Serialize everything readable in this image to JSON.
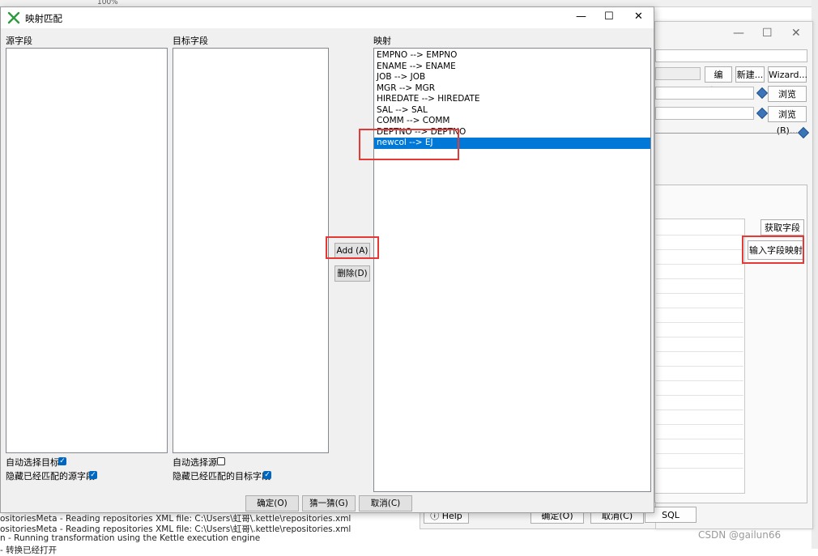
{
  "background": {
    "top_bar_text": "100%",
    "window_controls": [
      "—",
      "☐",
      "✕"
    ],
    "buttons": {
      "edit": "编辑...",
      "new": "新建...",
      "wizard": "Wizard...",
      "browse1": "浏览(B)...",
      "browse2": "浏览(B)...",
      "get_fields": "获取字段",
      "input_field_mapping": "输入字段映射",
      "help": "Help",
      "ok": "确定(O)",
      "cancel": "取消(C)",
      "sql": "SQL"
    },
    "log_lines": [
      "ositoriesMeta - Reading repositories XML file: C:\\Users\\虹哥\\.kettle\\repositories.xml",
      "ositoriesMeta - Reading repositories XML file: C:\\Users\\虹哥\\.kettle\\repositories.xml",
      "n - Running transformation using the Kettle execution engine",
      "- 转换已经打开"
    ]
  },
  "dialog": {
    "title": "映射匹配",
    "controls": {
      "minimize": "—",
      "maximize": "☐",
      "close": "✕"
    },
    "source_label": "源字段",
    "target_label": "目标字段",
    "mapping_label": "映射",
    "mappings": [
      "EMPNO --> EMPNO",
      "ENAME --> ENAME",
      "JOB --> JOB",
      "MGR --> MGR",
      "HIREDATE --> HIREDATE",
      "SAL --> SAL",
      "COMM --> COMM",
      "DEPTNO --> DEPTNO",
      "newcol --> EJ"
    ],
    "selected_index": 8,
    "add_button": "Add (A)",
    "delete_button": "删除(D)",
    "auto_select_target": "自动选择目标",
    "auto_select_target_checked": true,
    "hide_matched_source": "隐藏已经匹配的源字段",
    "hide_matched_source_checked": true,
    "auto_select_source": "自动选择源",
    "auto_select_source_checked": false,
    "hide_matched_target": "隐藏已经匹配的目标字段",
    "hide_matched_target_checked": true,
    "ok_button": "确定(O)",
    "guess_button": "猜一猜(G)",
    "cancel_button": "取消(C)"
  },
  "watermark": "CSDN @gailun66",
  "colors": {
    "selection": "#0078d7",
    "highlight_box": "#e53935",
    "checkbox": "#0067c0"
  }
}
